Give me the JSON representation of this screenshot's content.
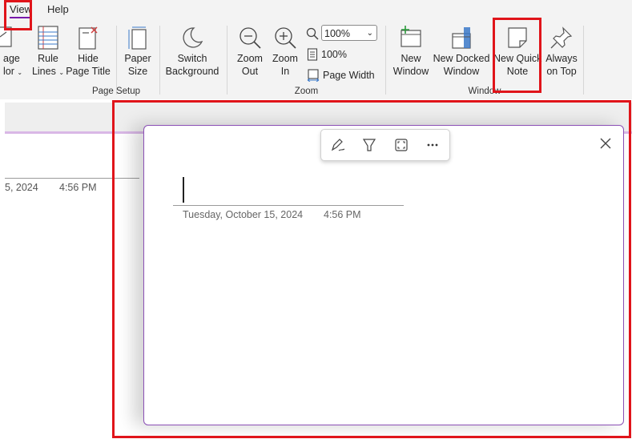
{
  "tabs": {
    "view": "View",
    "help": "Help"
  },
  "ribbon": {
    "page_color": {
      "line1": "age",
      "line2": "lor"
    },
    "rule_lines": {
      "line1": "Rule",
      "line2": "Lines"
    },
    "hide_page_title": {
      "line1": "Hide",
      "line2": "Page Title"
    },
    "paper_size": {
      "line1": "Paper",
      "line2": "Size"
    },
    "switch_background": {
      "line1": "Switch",
      "line2": "Background"
    },
    "zoom_out": {
      "line1": "Zoom",
      "line2": "Out"
    },
    "zoom_in": {
      "line1": "Zoom",
      "line2": "In"
    },
    "zoom_value": "100%",
    "zoom_100": "100%",
    "page_width": "Page Width",
    "new_window": {
      "line1": "New",
      "line2": "Window"
    },
    "new_docked_window": {
      "line1": "New Docked",
      "line2": "Window"
    },
    "new_quick_note": {
      "line1": "New Quick",
      "line2": "Note"
    },
    "always_on_top": {
      "line1": "Always",
      "line2": "on Top"
    },
    "groups": {
      "page_setup": "Page Setup",
      "zoom": "Zoom",
      "window": "Window"
    }
  },
  "background_page": {
    "date": "5, 2024",
    "time": "4:56 PM"
  },
  "quick_note": {
    "date": "Tuesday, October 15, 2024",
    "time": "4:56 PM",
    "tools": [
      "pen-icon",
      "highlighter-icon",
      "full-page-icon",
      "more-icon"
    ]
  },
  "colors": {
    "accent": "#7719aa",
    "highlight": "#e0141a",
    "note_border": "#8a4fb5"
  }
}
